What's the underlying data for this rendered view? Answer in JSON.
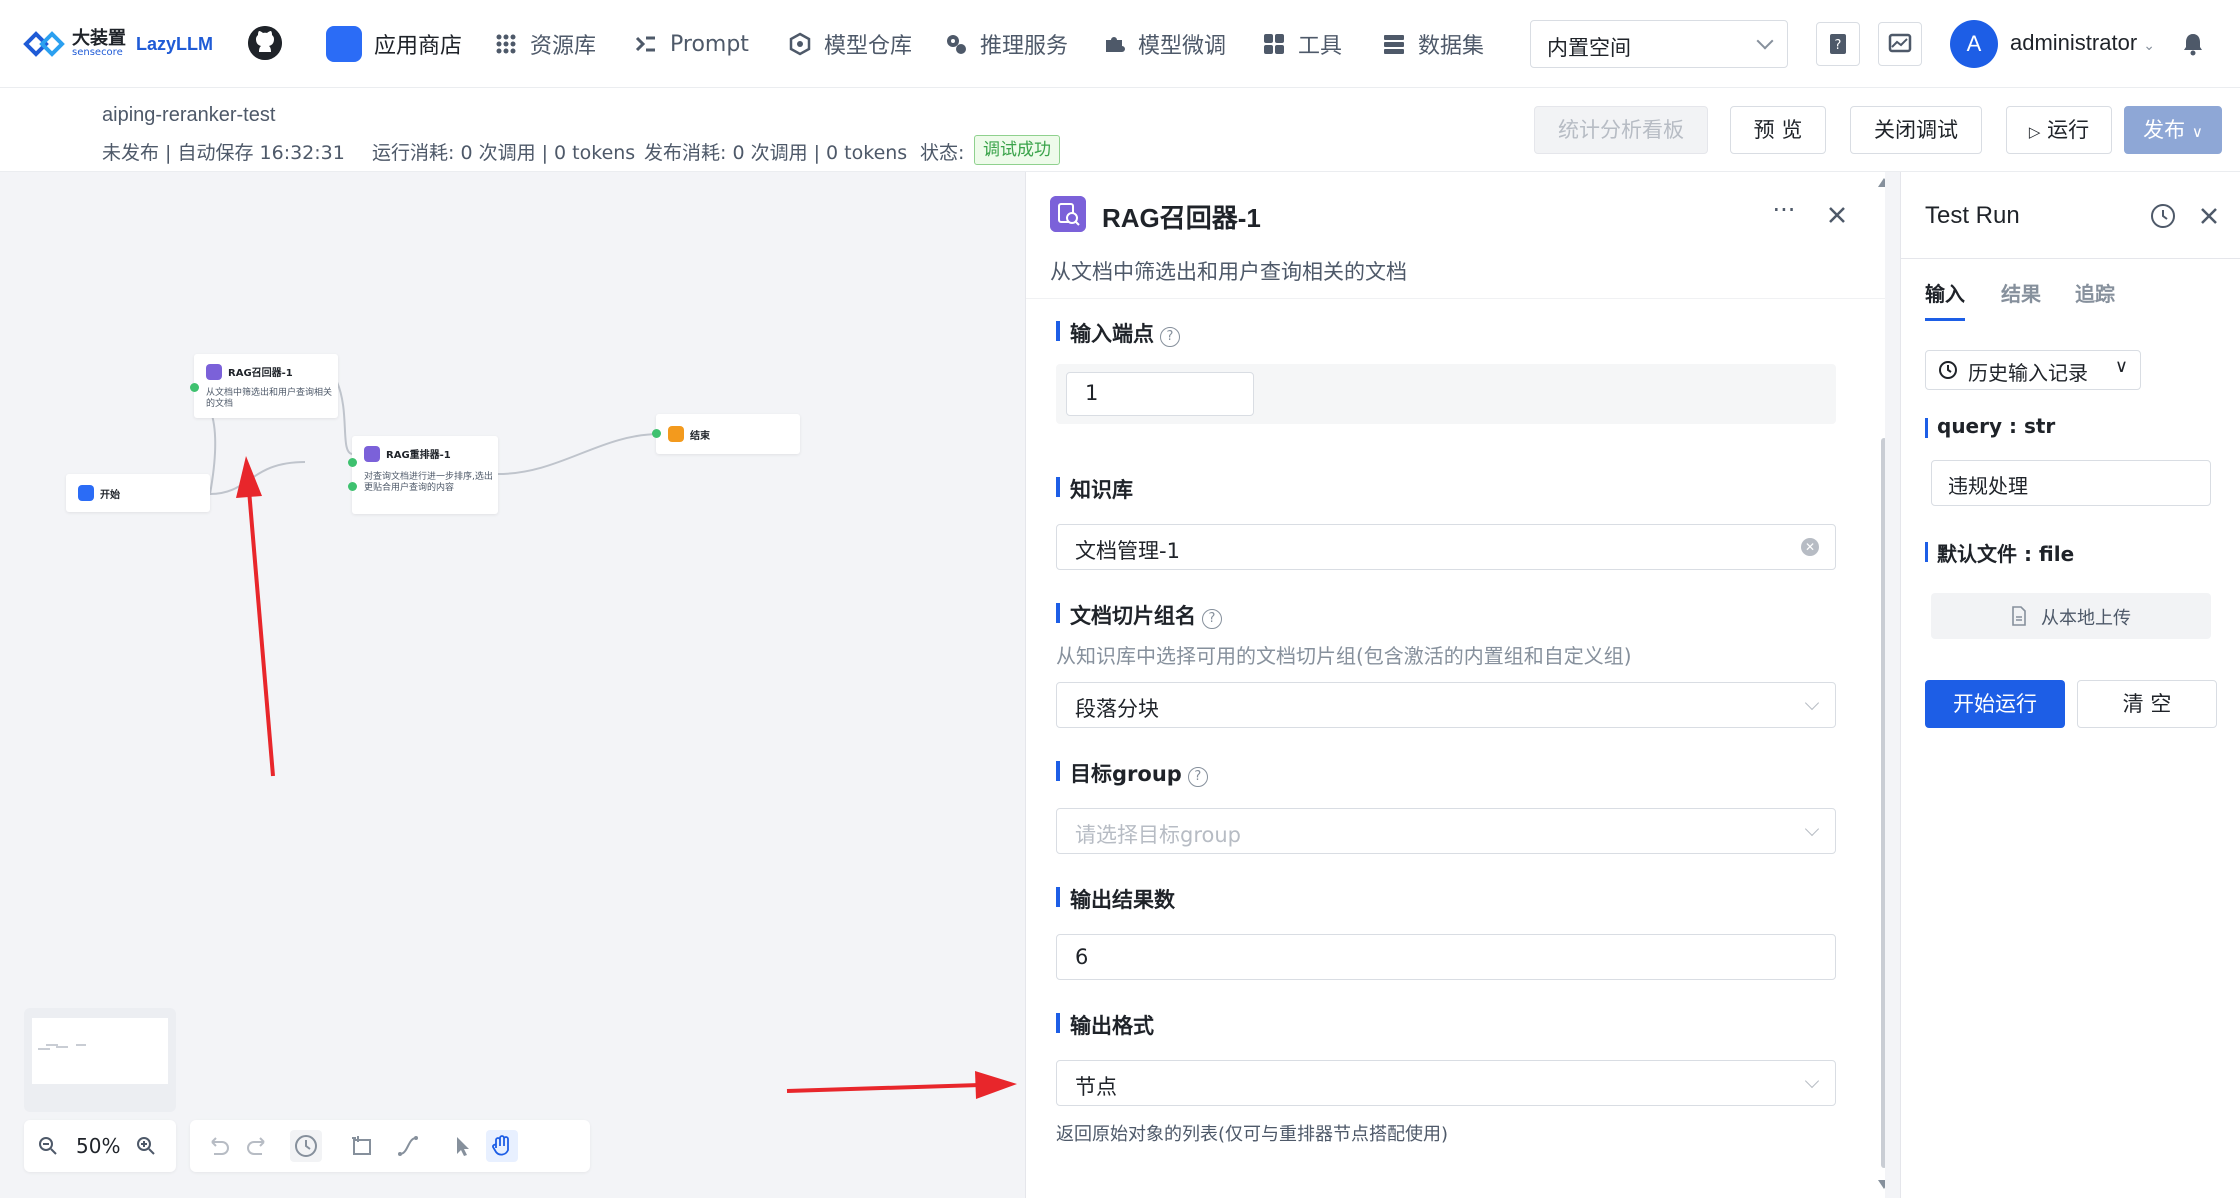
{
  "brand": {
    "name_cn": "大装置",
    "name_sub": "sensecore",
    "product": "LazyLLM"
  },
  "nav": {
    "items": [
      {
        "label": "应用商店",
        "icon": "store-icon",
        "active": true
      },
      {
        "label": "资源库",
        "icon": "grid-icon"
      },
      {
        "label": "Prompt",
        "icon": "prompt-icon"
      },
      {
        "label": "模型仓库",
        "icon": "cube-icon"
      },
      {
        "label": "推理服务",
        "icon": "gears-icon"
      },
      {
        "label": "模型微调",
        "icon": "puzzle-icon"
      },
      {
        "label": "工具",
        "icon": "apps-icon"
      },
      {
        "label": "数据集",
        "icon": "database-icon"
      }
    ],
    "space": "内置空间",
    "user": "administrator",
    "avatar_letter": "A"
  },
  "header": {
    "app_name": "aiping-reranker-test",
    "save_status": "未发布 | 自动保存 16:32:31",
    "run_cost": "运行消耗: 0 次调用 | 0 tokens",
    "publish_cost": "发布消耗: 0 次调用 | 0 tokens",
    "status_label": "状态:",
    "status_value": "调试成功",
    "buttons": {
      "analytics": "统计分析看板",
      "preview": "预 览",
      "close_debug": "关闭调试",
      "run": "运行",
      "publish": "发布"
    }
  },
  "canvas": {
    "nodes": {
      "start": {
        "title": "开始"
      },
      "retriever": {
        "title": "RAG召回器-1",
        "desc": "从文档中筛选出和用户查询相关的文档"
      },
      "reranker": {
        "title": "RAG重排器-1",
        "desc": "对查询文档进行进一步排序,选出更贴合用户查询的内容"
      },
      "end": {
        "title": "结束"
      }
    },
    "zoom": "50%"
  },
  "config": {
    "title": "RAG召回器-1",
    "description": "从文档中筛选出和用户查询相关的文档",
    "input_ports_label": "输入端点",
    "input_ports_value": "1",
    "kb_label": "知识库",
    "kb_value": "文档管理-1",
    "chunk_group_label": "文档切片组名",
    "chunk_group_hint": "从知识库中选择可用的文档切片组(包含激活的内置组和自定义组)",
    "chunk_group_value": "段落分块",
    "target_group_label": "目标group",
    "target_group_placeholder": "请选择目标group",
    "topk_label": "输出结果数",
    "topk_value": "6",
    "output_format_label": "输出格式",
    "output_format_value": "节点",
    "output_format_hint": "返回原始对象的列表(仅可与重排器节点搭配使用)"
  },
  "testrun": {
    "title": "Test Run",
    "tabs": [
      "输入",
      "结果",
      "追踪"
    ],
    "history": "历史输入记录",
    "query_label": "query : str",
    "query_value": "违规处理",
    "file_label": "默认文件 : file",
    "upload": "从本地上传",
    "run": "开始运行",
    "clear": "清 空"
  },
  "colors": {
    "accent": "#1d5ee6",
    "success": "#3aa34a",
    "node_purple": "#7b61d9",
    "annotation_red": "#e8262b"
  }
}
